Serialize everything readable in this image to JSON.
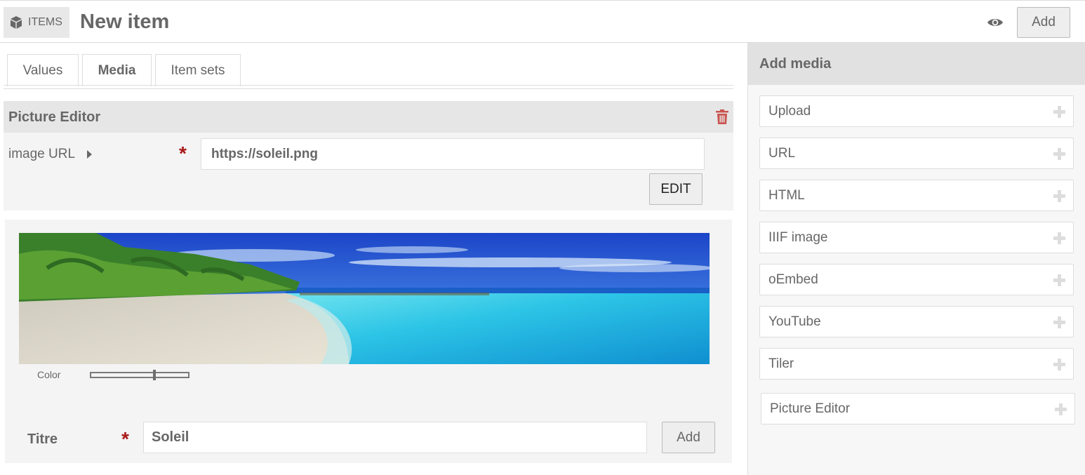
{
  "header": {
    "breadcrumb_label": "ITEMS",
    "page_title": "New item",
    "add_label": "Add"
  },
  "tabs": [
    {
      "label": "Values",
      "active": false
    },
    {
      "label": "Media",
      "active": true
    },
    {
      "label": "Item sets",
      "active": false
    }
  ],
  "picture_editor": {
    "title": "Picture Editor",
    "url_label": "image URL",
    "url_value": "https://soleil.png",
    "edit_label": "EDIT",
    "color_label": "Color",
    "color_slider_value": 0.66,
    "titre_label": "Titre",
    "titre_value": "Soleil",
    "titre_add_label": "Add"
  },
  "sidebar": {
    "title": "Add media",
    "items": [
      {
        "label": "Upload"
      },
      {
        "label": "URL"
      },
      {
        "label": "HTML"
      },
      {
        "label": "IIIF image"
      },
      {
        "label": "oEmbed"
      },
      {
        "label": "YouTube"
      },
      {
        "label": "Tiler"
      },
      {
        "label": "Picture Editor"
      }
    ]
  },
  "colors": {
    "text": "#676767",
    "required": "#a91919",
    "trash": "#c9534f",
    "panel": "#f4f4f4",
    "header_bg": "#e6e6e6"
  },
  "icons": {
    "breadcrumb": "cube-icon",
    "preview": "eye-icon",
    "delete": "trash-icon",
    "add": "plus-icon",
    "expand": "caret-right-icon"
  }
}
